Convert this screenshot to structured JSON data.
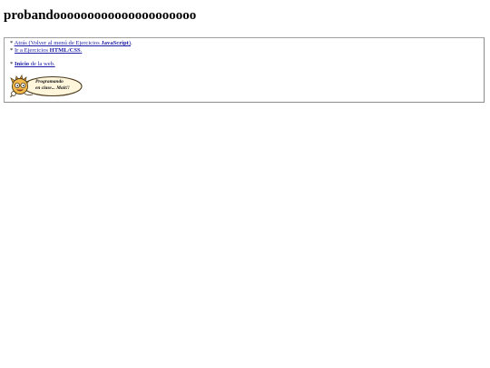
{
  "page": {
    "title": "probandooooooooooooooooooooo"
  },
  "nav": {
    "bullet": "*",
    "back": {
      "link_prefix": "Atrás (Volver al menú de Ejercicios ",
      "link_bold": "JavaScript",
      "link_suffix": ")"
    },
    "back_tail": ".",
    "html": {
      "link_prefix": "Ir a Ejercicios ",
      "link_bold": "HTML/CSS",
      "link_suffix": "."
    },
    "home": {
      "link_bold": "Inicio",
      "link_suffix": " de la web."
    }
  },
  "logo": {
    "icon": "cartoon-face-icon",
    "line1": "Programando",
    "line2": "en clase... Mait!!",
    "colors": {
      "face": "#f2b94a",
      "outline": "#4a3a1a",
      "badge": "#fff6dc"
    }
  }
}
